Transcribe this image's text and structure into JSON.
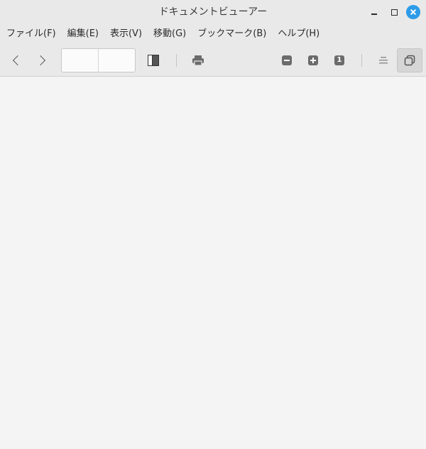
{
  "window": {
    "title": "ドキュメントビューアー"
  },
  "menubar": {
    "items": [
      {
        "label": "ファイル(F)"
      },
      {
        "label": "編集(E)"
      },
      {
        "label": "表示(V)"
      },
      {
        "label": "移動(G)"
      },
      {
        "label": "ブックマーク(B)"
      },
      {
        "label": "ヘルプ(H)"
      }
    ]
  },
  "toolbar": {
    "page_entry": {
      "current_value": "",
      "total_value": ""
    },
    "zoom_reset_label": "1",
    "icons": [
      "chevron-left-icon",
      "chevron-right-icon",
      "sidebar-icon",
      "printer-icon",
      "zoom-out-icon",
      "zoom-in-icon",
      "zoom-one-icon",
      "align-icon",
      "dual-page-icon"
    ]
  },
  "colors": {
    "titlebar_bg": "#e9e9e9",
    "content_bg": "#f4f4f4",
    "close_button": "#2d9be8"
  }
}
